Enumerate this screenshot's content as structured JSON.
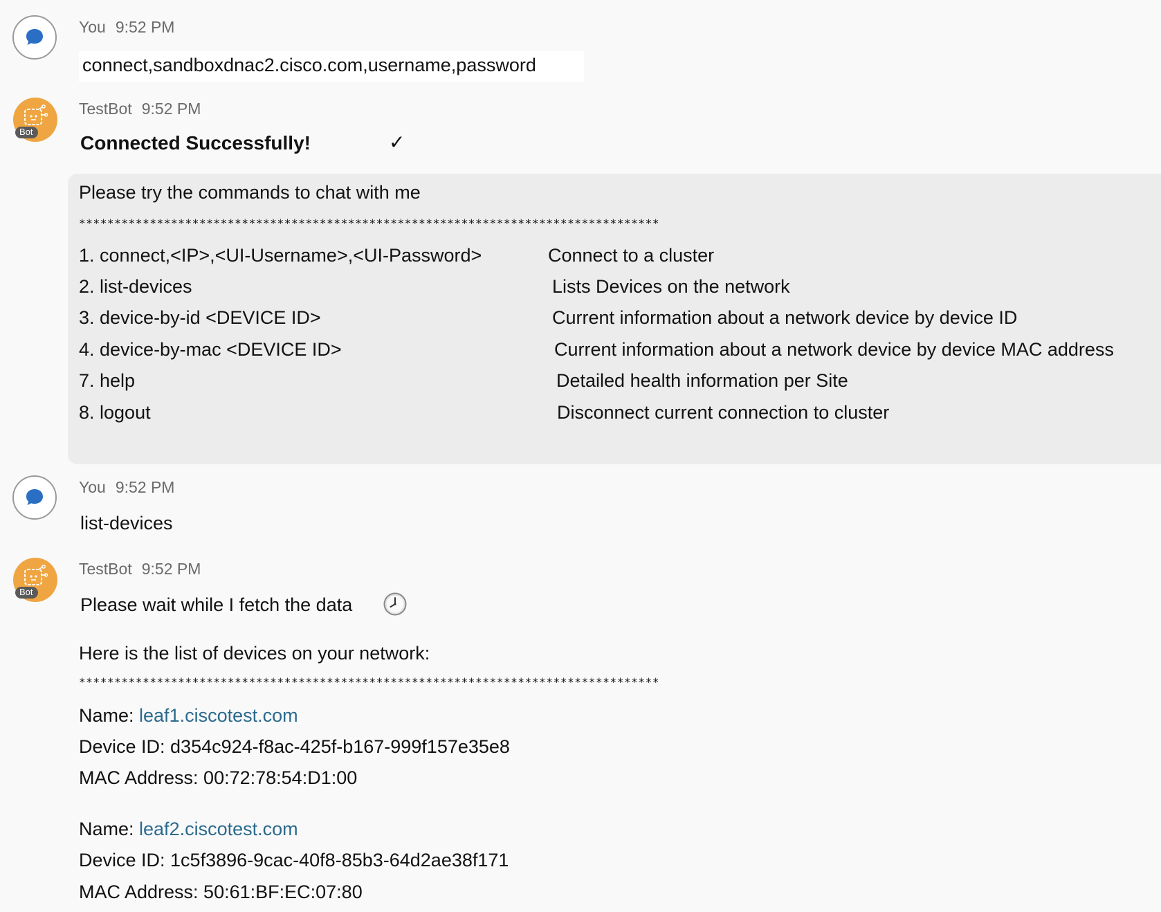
{
  "messages": {
    "m1": {
      "sender": "You",
      "time": "9:52 PM",
      "text": "connect,sandboxdnac2.cisco.com,username,password"
    },
    "m2": {
      "sender": "TestBot",
      "time": "9:52 PM",
      "badge": "Bot",
      "success_text": "Connected Successfully!",
      "check_glyph": "✓",
      "card": {
        "intro": "Please try the commands to chat with me",
        "separator": "**********************************************************************************",
        "commands": [
          {
            "cmd": "1. connect,<IP>,<UI-Username>,<UI-Password>",
            "desc": "Connect to a cluster"
          },
          {
            "cmd": "2. list-devices",
            "desc": "Lists Devices on the network"
          },
          {
            "cmd": "3. device-by-id <DEVICE ID>",
            "desc": "Current information about a network device by device ID"
          },
          {
            "cmd": "4. device-by-mac <DEVICE ID>",
            "desc": "Current information about a network device by device MAC address"
          },
          {
            "cmd": "7. help",
            "desc": "Detailed health information per Site"
          },
          {
            "cmd": "8. logout",
            "desc": "Disconnect current connection to cluster"
          }
        ]
      }
    },
    "m3": {
      "sender": "You",
      "time": "9:52 PM",
      "text": "list-devices"
    },
    "m4": {
      "sender": "TestBot",
      "time": "9:52 PM",
      "badge": "Bot",
      "wait_text": "Please wait while I fetch the data",
      "clock_icon": "clock-icon",
      "list_intro": "Here is the list of devices on your network:",
      "separator": "**********************************************************************************",
      "devices": [
        {
          "name_label": "Name: ",
          "name": "leaf1.ciscotest.com",
          "id_line": "Device ID: d354c924-f8ac-425f-b167-999f157e35e8",
          "mac_line": "MAC Address: 00:72:78:54:D1:00"
        },
        {
          "name_label": "Name: ",
          "name": "leaf2.ciscotest.com",
          "id_line": "Device ID: 1c5f3896-9cac-40f8-85b3-64d2ae38f171",
          "mac_line": "MAC Address: 50:61:BF:EC:07:80"
        }
      ]
    }
  },
  "colors": {
    "background": "#f9f9fa",
    "bot_avatar": "#efa642",
    "user_icon": "#2a6fc4",
    "card": "#ececec",
    "link": "#2b6a8c"
  }
}
